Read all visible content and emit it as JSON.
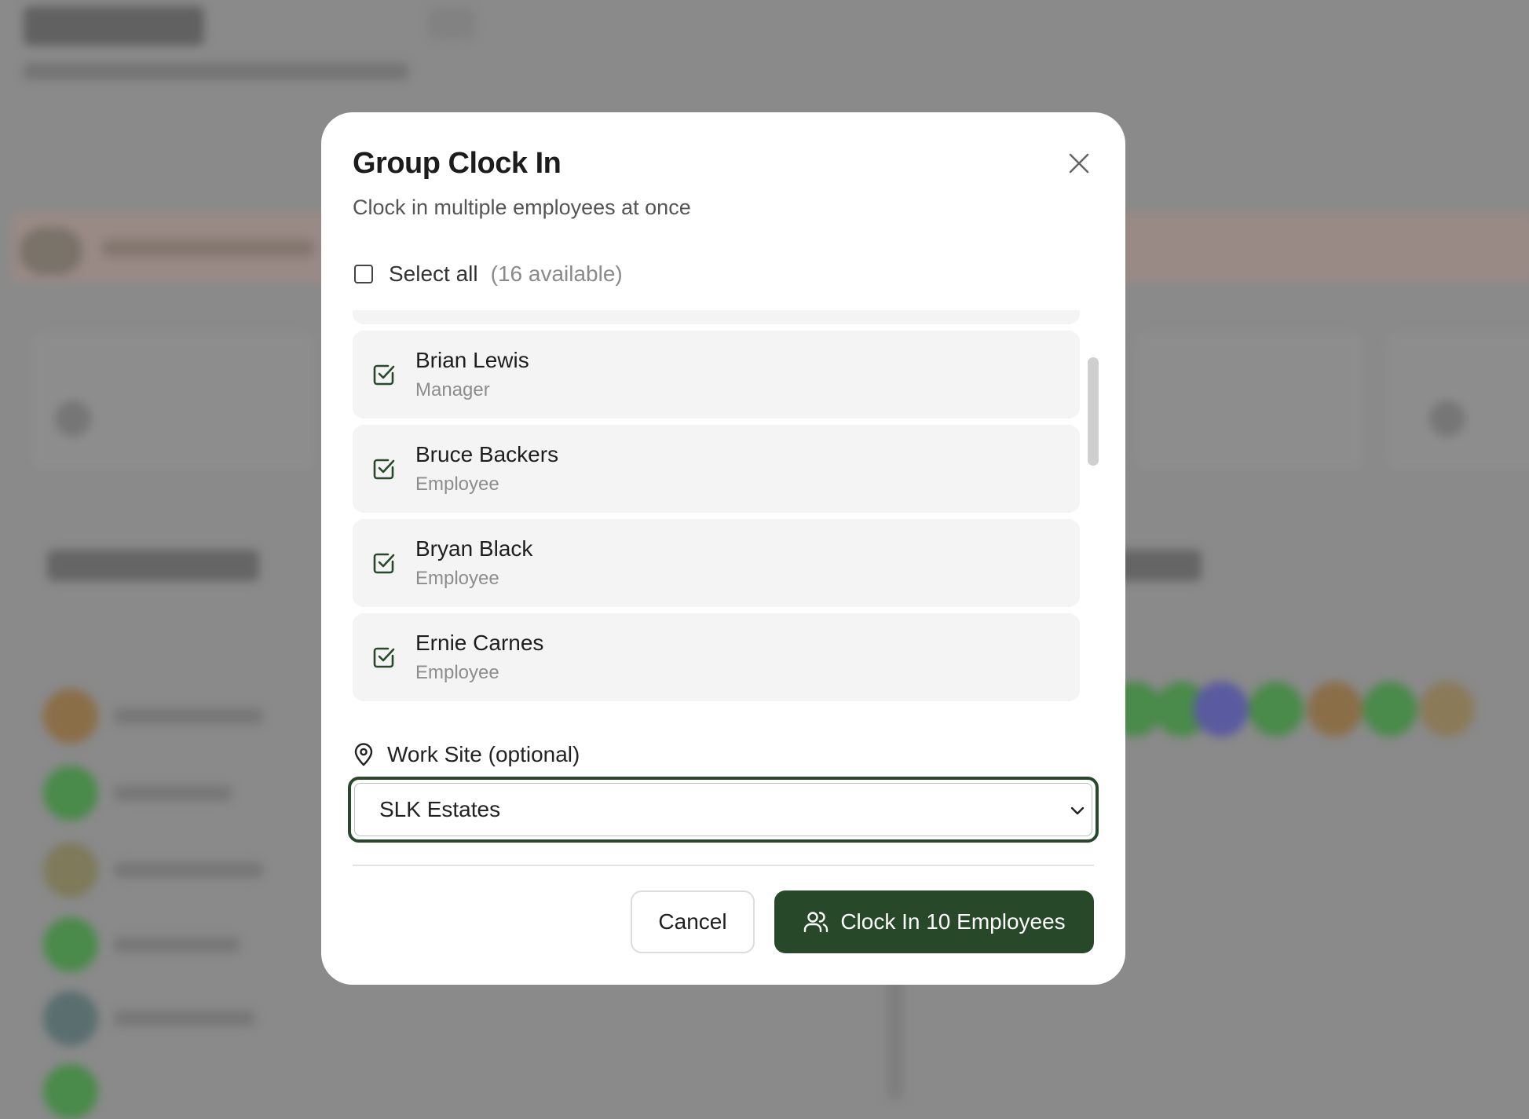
{
  "modal": {
    "title": "Group Clock In",
    "subtitle": "Clock in multiple employees at once",
    "select_all_label": "Select all",
    "select_all_count": "(16 available)",
    "employees": [
      {
        "name": "Brian Lewis",
        "role": "Manager",
        "checked": true
      },
      {
        "name": "Bruce Backers",
        "role": "Employee",
        "checked": true
      },
      {
        "name": "Bryan Black",
        "role": "Employee",
        "checked": true
      },
      {
        "name": "Ernie Carnes",
        "role": "Employee",
        "checked": true
      }
    ],
    "worksite": {
      "label": "Work Site (optional)",
      "selected": "SLK Estates"
    },
    "buttons": {
      "cancel": "Cancel",
      "confirm": "Clock In 10 Employees"
    }
  },
  "colors": {
    "accent": "#27492a",
    "item_background": "#f4f4f4",
    "overlay": "#8a8a8a"
  },
  "icons": {
    "close": "close-icon",
    "checkbox_checked": "checkbox-checked-icon",
    "map_pin": "map-pin-icon",
    "chevron": "chevron-down-icon",
    "users": "users-icon"
  }
}
